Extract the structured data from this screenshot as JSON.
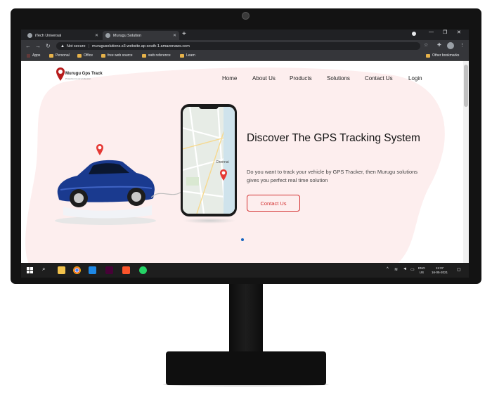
{
  "browser": {
    "tabs": [
      {
        "title": "iTech Universal"
      },
      {
        "title": "Murugu Solution"
      }
    ],
    "new_tab_symbol": "+",
    "address": {
      "security_label": "Not secure",
      "url": "murugusolutions.s3-website.ap-south-1.amazonaws.com"
    },
    "bookmarks": [
      {
        "label": "Apps",
        "icon": "apps-grid-icon"
      },
      {
        "label": "Personal",
        "icon": "folder-icon"
      },
      {
        "label": "Office",
        "icon": "folder-icon"
      },
      {
        "label": "free web source",
        "icon": "folder-icon"
      },
      {
        "label": "web reference",
        "icon": "folder-icon"
      },
      {
        "label": "Learn",
        "icon": "folder-icon"
      }
    ],
    "other_bookmarks": "Other bookmarks"
  },
  "site": {
    "logo": {
      "title": "Murugu Gps Track",
      "tagline": "Protection is our profession"
    },
    "nav": [
      "Home",
      "About Us",
      "Products",
      "Solutions",
      "Contact Us",
      "Login"
    ],
    "hero": {
      "title": "Discover The GPS Tracking System",
      "description": "Do you want to track your vehicle by GPS Tracker, then Murugu solutions gives you perfect real time solution",
      "button": "Contact Us"
    },
    "map_label": "Chennai"
  },
  "taskbar": {
    "apps": [
      "start-icon",
      "search-icon",
      "file-explorer-icon",
      "chrome-icon",
      "vscode-icon",
      "adobe-xd-icon",
      "brave-icon",
      "whatsapp-icon"
    ],
    "language": "ENG",
    "region": "US",
    "time": "11:37",
    "date": "16-05-2021"
  },
  "colors": {
    "accent_red": "#d32f2f",
    "hero_background": "#fdeeee",
    "car_blue": "#1a3a8f",
    "slider_active": "#1565c0"
  }
}
